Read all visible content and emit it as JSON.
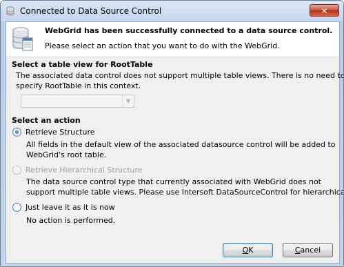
{
  "window": {
    "title": "Connected to Data Source Control",
    "close_glyph": "✕"
  },
  "header": {
    "title": "WebGrid has been successfully connected to a data source control.",
    "subtitle": "Please select an action that you want to do with the WebGrid."
  },
  "table_view": {
    "label": "Select a table view for RootTable",
    "desc_line1": "The associated data control does not support multiple table views. There is no need to",
    "desc_line2": "specify RootTable in this context.",
    "combo_value": ""
  },
  "action": {
    "label": "Select an action",
    "options": [
      {
        "label": "Retrieve Structure",
        "checked": true,
        "enabled": true,
        "desc_line1": "All fields in the default view of the associated datasource control will be added to",
        "desc_line2": "WebGrid's root table."
      },
      {
        "label": "Retrieve Hierarchical Structure",
        "checked": false,
        "enabled": false,
        "desc_line1": "The data source control type that currently associated with WebGrid does not",
        "desc_line2": "support multiple table views. Please use Intersoft DataSourceControl for hierarchical"
      },
      {
        "label": "Just leave it as it is now",
        "checked": false,
        "enabled": true,
        "desc_line1": "No action is performed."
      }
    ]
  },
  "buttons": {
    "ok_mnemonic": "O",
    "ok_rest": "K",
    "cancel_mnemonic": "C",
    "cancel_rest": "ancel"
  },
  "icons": {
    "title_icon": "database-icon",
    "header_icon": "database-icon"
  }
}
